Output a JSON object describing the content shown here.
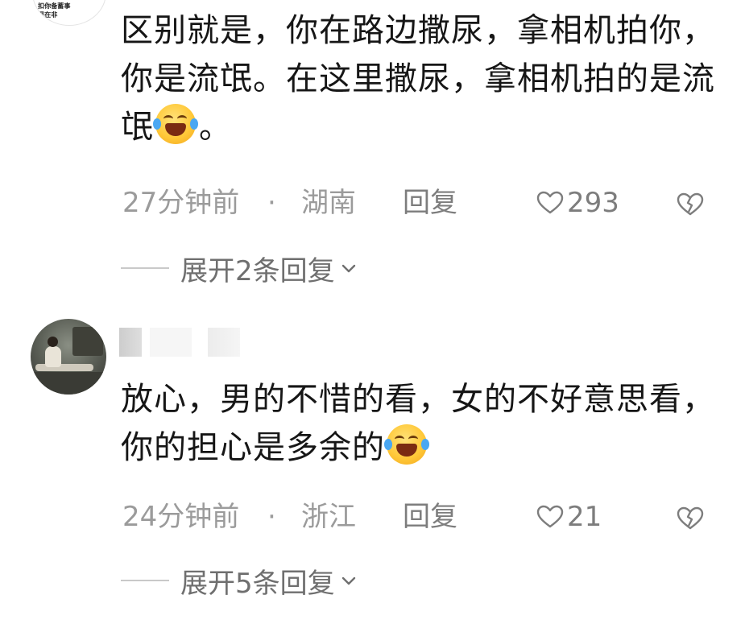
{
  "comments": [
    {
      "avatar_text": "扣你备蓄事\n现在非",
      "content": "区别就是，你在路边撒尿，拿相机拍你，你是流氓。在这里撒尿，拿相机拍的是流氓",
      "content_tail": "。",
      "emoji": "laughing-crying-emoji",
      "time": "27分钟前",
      "separator": "·",
      "region": "湖南",
      "reply_label": "回复",
      "likes": "293",
      "expand_label": "展开2条回复"
    },
    {
      "content": "放心，男的不惜的看，女的不好意思看，你的担心是多余的",
      "content_tail": "",
      "emoji": "laughing-crying-emoji",
      "time": "24分钟前",
      "separator": "·",
      "region": "浙江",
      "reply_label": "回复",
      "likes": "21",
      "expand_label": "展开5条回复"
    }
  ],
  "colors": {
    "text": "#161616",
    "meta": "#9b9b9b",
    "action": "#7d7d7d",
    "emoji_yellow": "#ffc93a",
    "tear_blue": "#4aa7f2"
  }
}
